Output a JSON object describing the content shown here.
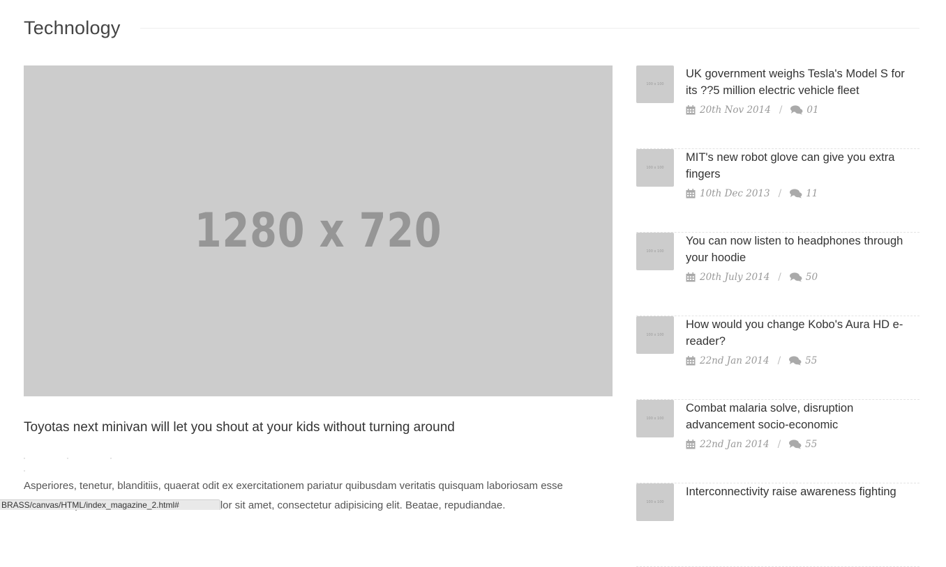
{
  "section": {
    "title": "Technology"
  },
  "featured": {
    "image_label": "1280 x 720",
    "title": "Toyotas next minivan will let you shout at your kids without turning around",
    "excerpt": "Asperiores, tenetur, blanditiis, quaerat odit ex exercitationem pariatur quibusdam veritatis quisquam laboriosam esse beatae hic perferendis velit deserunt … dolor sit amet, consectetur adipisicing elit. Beatae, repudiandae."
  },
  "status_bar": {
    "text": "BRASS/canvas/HTML/index_magazine_2.html#"
  },
  "side_posts": [
    {
      "thumb_label": "100 x 100",
      "title": "UK government weighs Tesla's Model S for its ??5 million electric vehicle fleet",
      "date": "20th Nov 2014",
      "comments": "01"
    },
    {
      "thumb_label": "100 x 100",
      "title": "MIT's new robot glove can give you extra fingers",
      "date": "10th Dec 2013",
      "comments": "11"
    },
    {
      "thumb_label": "100 x 100",
      "title": "You can now listen to headphones through your hoodie",
      "date": "20th July 2014",
      "comments": "50"
    },
    {
      "thumb_label": "100 x 100",
      "title": "How would you change Kobo's Aura HD e-reader?",
      "date": "22nd Jan 2014",
      "comments": "55"
    },
    {
      "thumb_label": "100 x 100",
      "title": "Combat malaria solve, disruption advancement socio-economic",
      "date": "22nd Jan 2014",
      "comments": "55"
    },
    {
      "thumb_label": "100 x 100",
      "title": "Interconnectivity raise awareness fighting",
      "date": "",
      "comments": ""
    }
  ],
  "icons": {
    "date": "calendar-icon",
    "comments": "comments-icon"
  }
}
